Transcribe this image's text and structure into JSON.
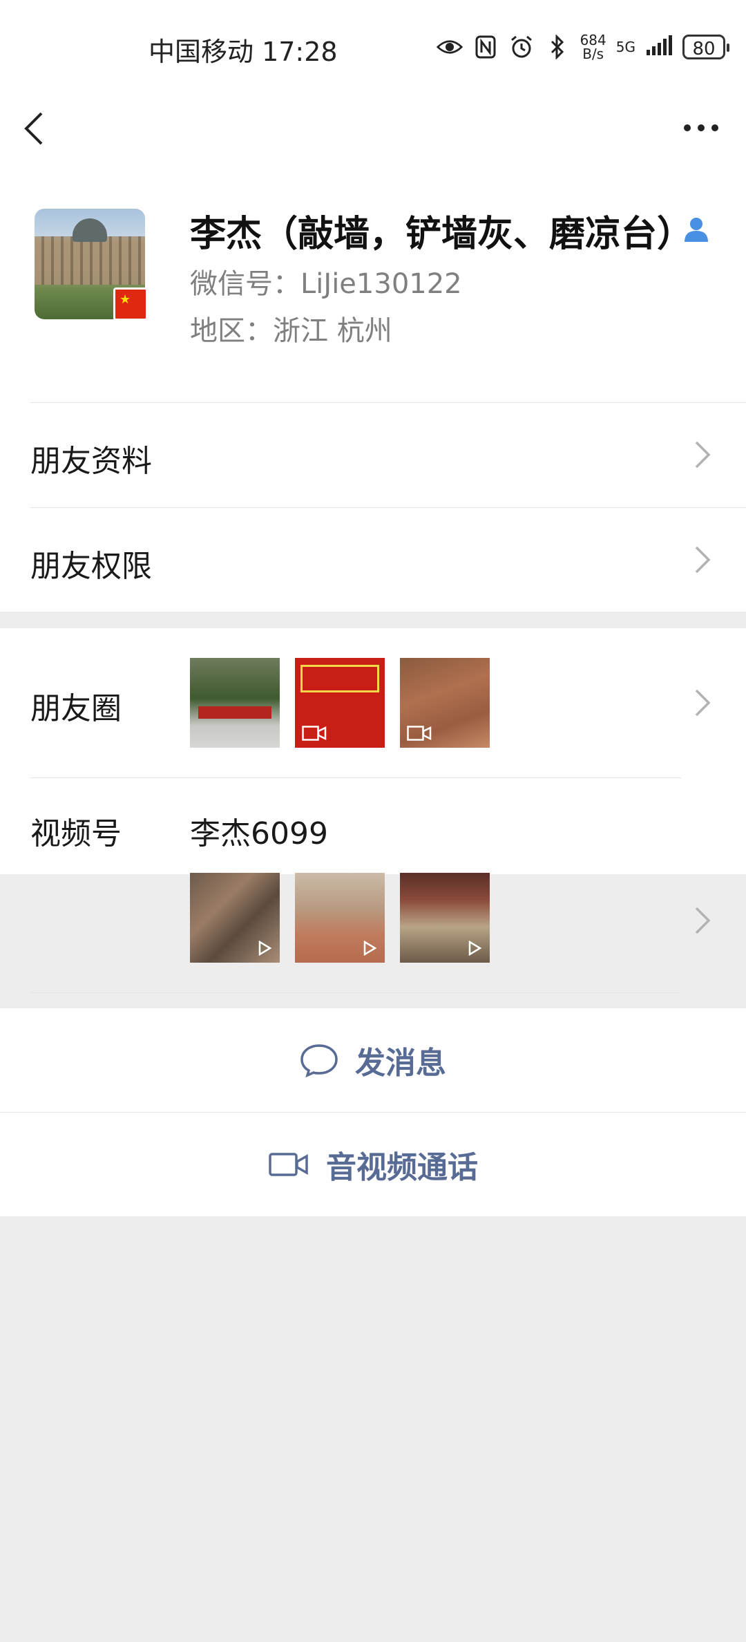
{
  "status_bar": {
    "carrier_time": "中国移动 17:28",
    "net_speed_value": "684",
    "net_speed_unit": "B/s",
    "network": "5G",
    "battery": "80"
  },
  "nav": {
    "back_icon": "chevron-left-icon",
    "more_icon": "more-dots-icon"
  },
  "profile": {
    "name": "李杰（敲墙，铲墙灰、磨凉台）",
    "wechat_id": "微信号：LiJie130122",
    "region": "地区：浙江  杭州"
  },
  "menu": {
    "friend_info": "朋友资料",
    "friend_permissions": "朋友权限"
  },
  "moments": {
    "label": "朋友圈"
  },
  "channels": {
    "label": "视频号",
    "name": "李杰6099"
  },
  "actions": {
    "message": "发消息",
    "call": "音视频通话"
  },
  "colors": {
    "link": "#576b95",
    "background": "#ededed"
  }
}
